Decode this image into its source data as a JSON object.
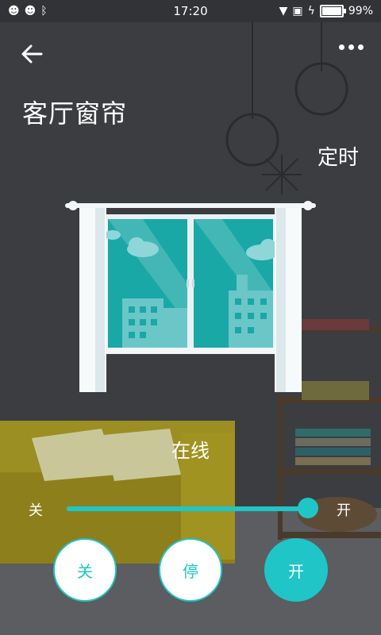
{
  "statusbar": {
    "time": "17:20",
    "battery": "99%",
    "battery_level": 0.99
  },
  "header": {
    "title": "客厅窗帘",
    "timer_label": "定时"
  },
  "device": {
    "status": "在线"
  },
  "slider": {
    "min_label": "关",
    "max_label": "开",
    "position": 0.98
  },
  "controls": {
    "close_label": "关",
    "stop_label": "停",
    "open_label": "开"
  },
  "colors": {
    "accent": "#1fc5c7",
    "background": "#3a3c3f"
  }
}
